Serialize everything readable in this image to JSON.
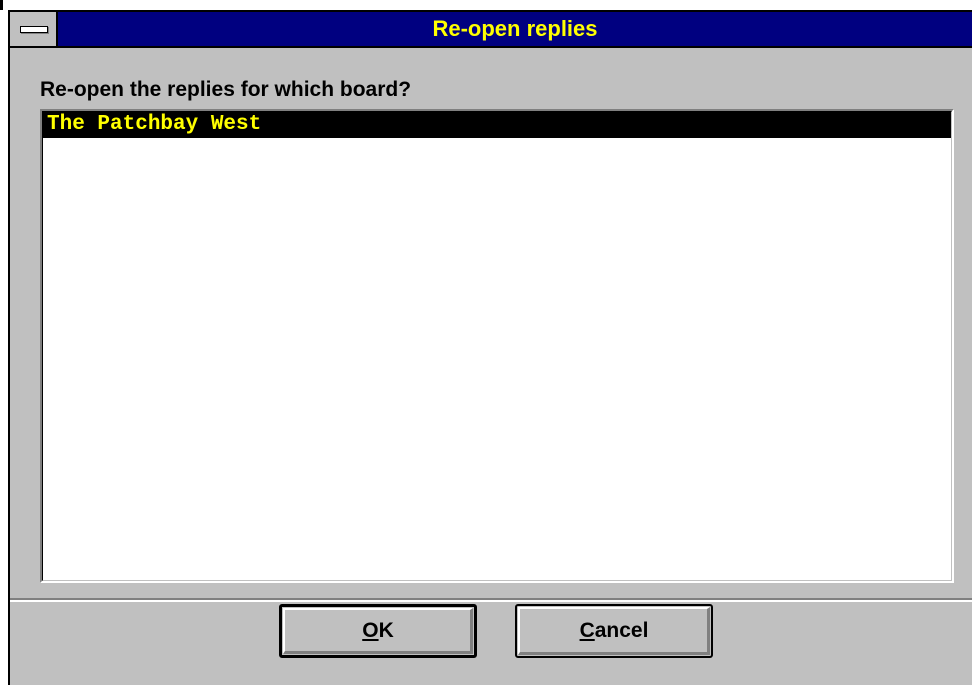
{
  "window": {
    "title": "Re-open replies",
    "prompt": "Re-open the replies for which board?"
  },
  "list": {
    "items": [
      {
        "label": "The Patchbay West",
        "selected": true
      }
    ]
  },
  "buttons": {
    "ok": {
      "mnemonic": "O",
      "rest": "K"
    },
    "cancel": {
      "mnemonic": "C",
      "rest": "ancel"
    }
  },
  "colors": {
    "titlebar": "#000080",
    "title_text": "#ffff00",
    "face": "#c0c0c0",
    "selection_bg": "#000000",
    "selection_text": "#ffff00"
  }
}
